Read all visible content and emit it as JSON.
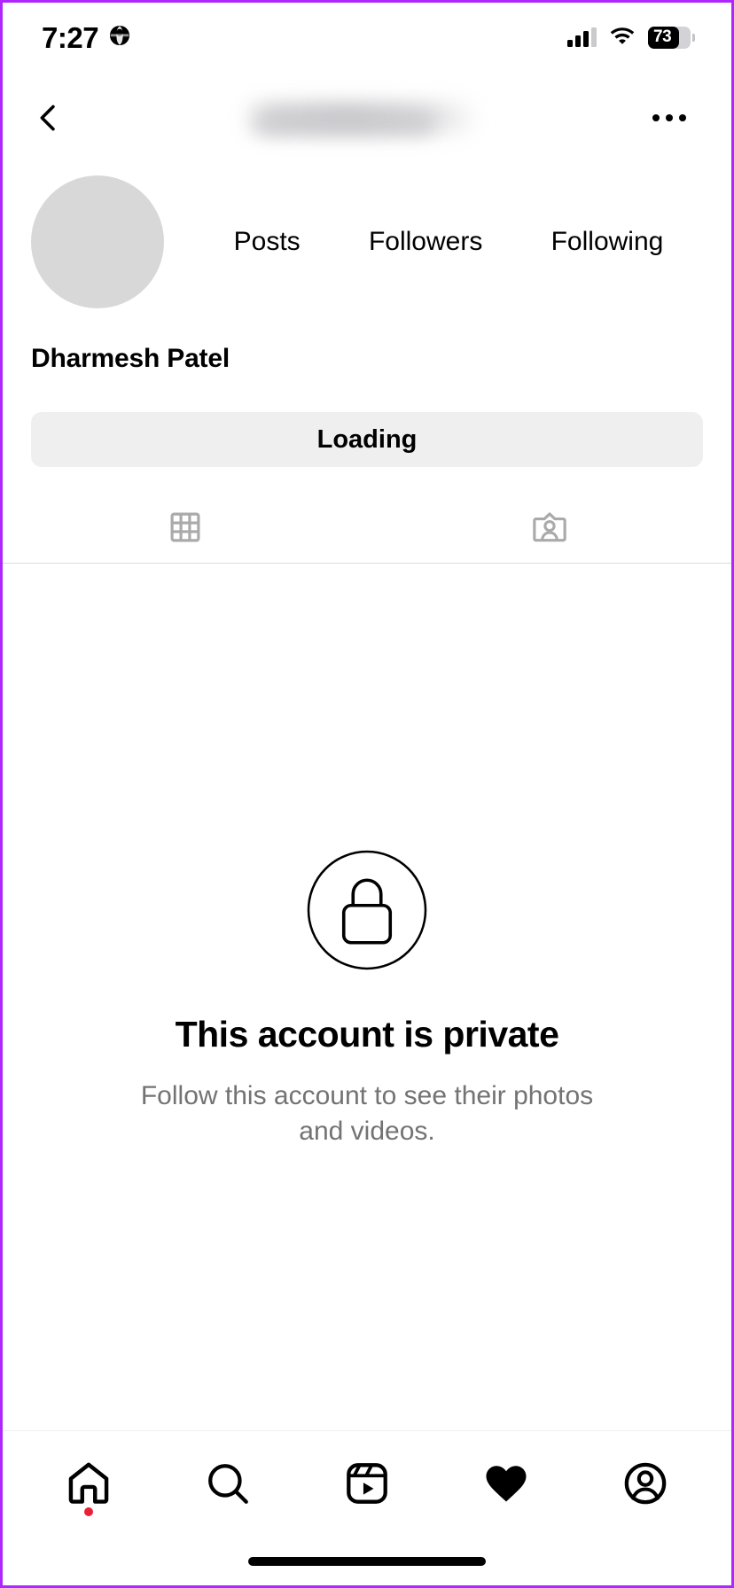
{
  "status_bar": {
    "time": "7:27",
    "location_icon": "globe-icon",
    "signal_icon": "cellular-signal-icon",
    "wifi_icon": "wifi-icon",
    "battery_level": "73",
    "battery_percent": 73
  },
  "topbar": {
    "back_icon": "chevron-left-icon",
    "username": "",
    "username_state": "blurred",
    "more_icon": "ellipsis-icon"
  },
  "profile": {
    "avatar_label": "profile-picture",
    "display_name": "Dharmesh Patel",
    "stats": [
      {
        "count": "",
        "label": "Posts"
      },
      {
        "count": "",
        "label": "Followers"
      },
      {
        "count": "",
        "label": "Following"
      }
    ]
  },
  "action": {
    "primary_label": "Loading"
  },
  "tabs": [
    {
      "name": "grid-tab",
      "icon": "grid-icon",
      "selected": false
    },
    {
      "name": "tagged-tab",
      "icon": "tagged-person-icon",
      "selected": false
    }
  ],
  "private_notice": {
    "icon": "lock-circle-icon",
    "title": "This account is private",
    "subtitle": "Follow this account to see their photos and videos."
  },
  "bottom_nav": [
    {
      "name": "home",
      "icon": "home-icon",
      "active": false,
      "badge": true
    },
    {
      "name": "search",
      "icon": "search-icon",
      "active": false,
      "badge": false
    },
    {
      "name": "reels",
      "icon": "reels-icon",
      "active": false,
      "badge": false
    },
    {
      "name": "activity",
      "icon": "heart-filled-icon",
      "active": true,
      "badge": false
    },
    {
      "name": "profile",
      "icon": "account-circle-icon",
      "active": false,
      "badge": false
    }
  ],
  "colors": {
    "background": "#ffffff",
    "text_primary": "#000000",
    "text_secondary": "#737373",
    "button_bg": "#efefef",
    "divider": "#dbdbdb",
    "avatar_placeholder": "#d8d8d8",
    "icon_inactive": "#aaaaaa",
    "notification_dot": "#e8203a",
    "frame_border": "#b026ff"
  }
}
